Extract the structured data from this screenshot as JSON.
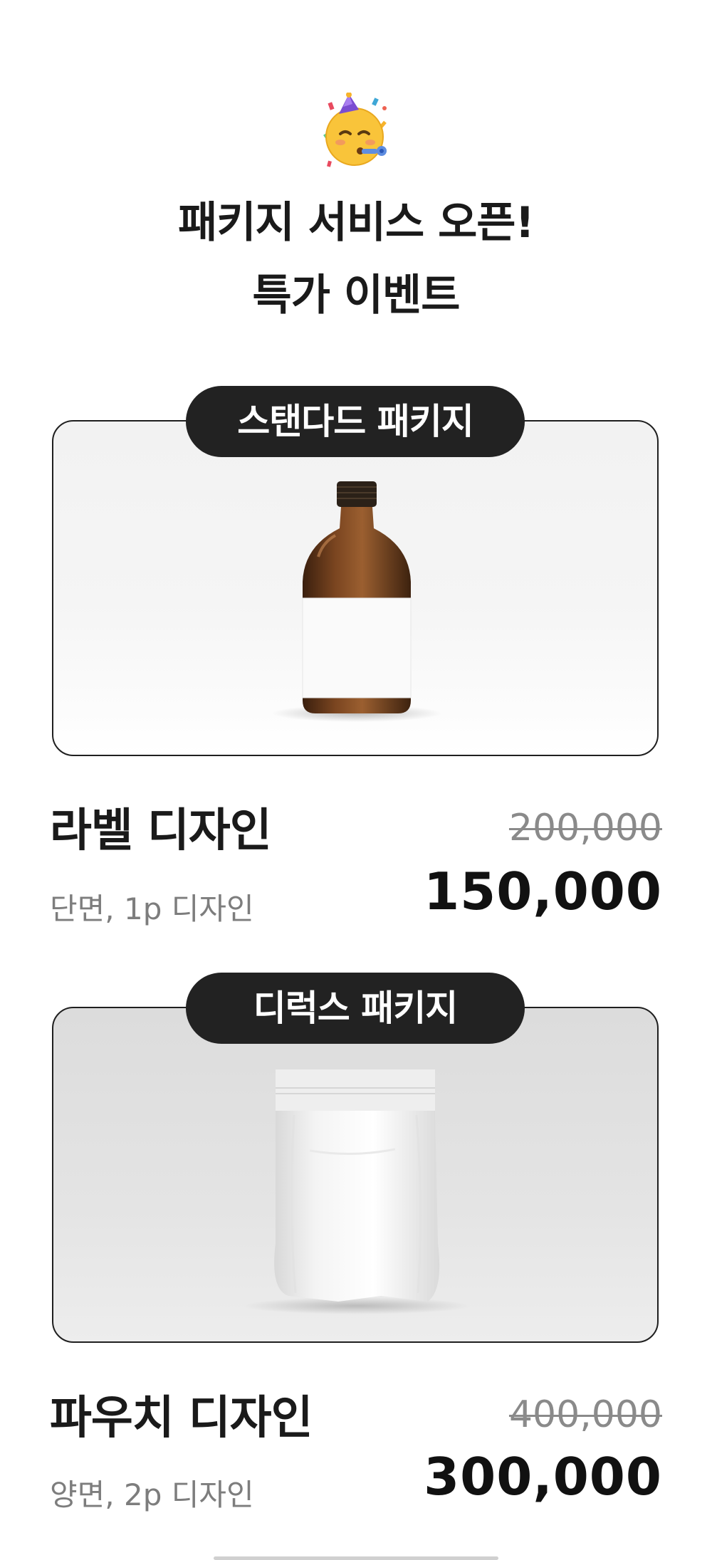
{
  "header": {
    "emoji": "partying-face-icon",
    "title_line1": "패키지 서비스 오픈!",
    "title_line2": "특가 이벤트"
  },
  "packages": [
    {
      "badge": "스탠다드 패키지",
      "image": "amber-bottle-illustration",
      "title": "라벨 디자인",
      "subtitle": "단면, 1p 디자인",
      "old_price": "200,000",
      "new_price": "150,000"
    },
    {
      "badge": "디럭스 패키지",
      "image": "white-pouch-illustration",
      "title": "파우치 디자인",
      "subtitle": "양면, 2p 디자인",
      "old_price": "400,000",
      "new_price": "300,000"
    }
  ],
  "colors": {
    "badge_bg": "#222222",
    "badge_text": "#ffffff",
    "title_text": "#1a1a1a",
    "muted_text": "#7d7d7d",
    "strike_text": "#8a8a8a"
  }
}
